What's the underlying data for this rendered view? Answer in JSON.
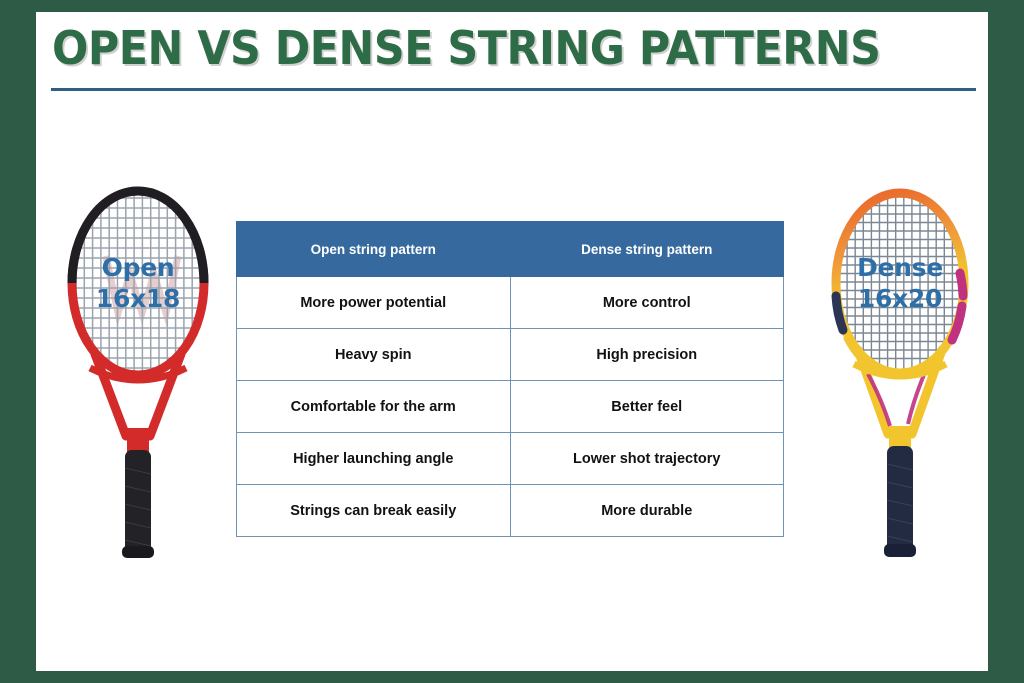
{
  "page": {
    "title": "OPEN VS DENSE STRING PATTERNS",
    "border_color": "#2E5B45",
    "background_color": "#FFFFFF",
    "title_color": "#2E6B47",
    "rule_color": "#2F5E80",
    "accent_blue": "#36699E",
    "label_blue": "#2E6FA8"
  },
  "table": {
    "headers": [
      "Open string pattern",
      "Dense string pattern"
    ],
    "rows": [
      [
        "More power potential",
        "More control"
      ],
      [
        "Heavy spin",
        "High precision"
      ],
      [
        "Comfortable for the arm",
        "Better feel"
      ],
      [
        "Higher launching angle",
        "Lower shot trajectory"
      ],
      [
        "Strings can break easily",
        "More durable"
      ]
    ]
  },
  "rackets": {
    "left": {
      "label_line1": "Open",
      "label_line2": "16x18",
      "frame_color": "#D32A2A",
      "frame_top_color": "#1F1F23",
      "grip_color": "#232327",
      "string_color": "#9AA3AE",
      "crosses": 18,
      "mains": 16
    },
    "right": {
      "label_line1": "Dense",
      "label_line2": "16x20",
      "frame_color_top": "#E8622A",
      "frame_color_mid": "#F2C52E",
      "frame_color_accent": "#C0317F",
      "frame_color_dark": "#2C3556",
      "grip_color": "#232B42",
      "string_color": "#7D8794",
      "crosses": 20,
      "mains": 16
    }
  }
}
